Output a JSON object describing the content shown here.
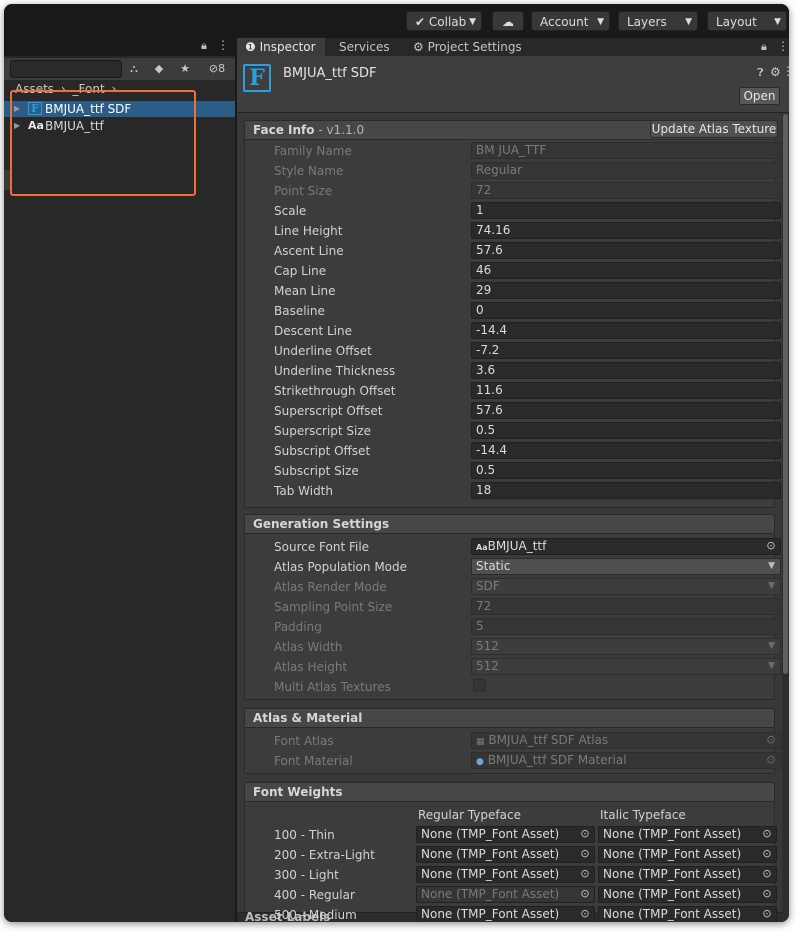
{
  "toolbar": {
    "collab_label": "Collab",
    "account_label": "Account",
    "layers_label": "Layers",
    "layout_label": "Layout"
  },
  "project": {
    "hidden_count": "8",
    "breadcrumb": [
      "Assets",
      "_Font"
    ],
    "items": [
      {
        "label": "BMJUA_ttf SDF",
        "icon": "F",
        "selected": true
      },
      {
        "label": "BMJUA_ttf",
        "icon": "Aa",
        "selected": false
      }
    ]
  },
  "inspector": {
    "tabs": [
      "Inspector",
      "Services",
      "Project Settings"
    ],
    "asset_title": "BMJUA_ttf SDF",
    "open_label": "Open",
    "face_info": {
      "title": "Face Info",
      "version": " - v1.1.0",
      "update_label": "Update Atlas Texture",
      "rows": [
        {
          "label": "Family Name",
          "value": "BM JUA_TTF",
          "disabled": true
        },
        {
          "label": "Style Name",
          "value": "Regular",
          "disabled": true
        },
        {
          "label": "Point Size",
          "value": "72",
          "disabled": true
        },
        {
          "label": "Scale",
          "value": "1",
          "disabled": false
        },
        {
          "label": "Line Height",
          "value": "74.16",
          "disabled": false
        },
        {
          "label": "Ascent Line",
          "value": "57.6",
          "disabled": false
        },
        {
          "label": "Cap Line",
          "value": "46",
          "disabled": false
        },
        {
          "label": "Mean Line",
          "value": "29",
          "disabled": false
        },
        {
          "label": "Baseline",
          "value": "0",
          "disabled": false
        },
        {
          "label": "Descent Line",
          "value": "-14.4",
          "disabled": false
        },
        {
          "label": "Underline Offset",
          "value": "-7.2",
          "disabled": false
        },
        {
          "label": "Underline Thickness",
          "value": "3.6",
          "disabled": false
        },
        {
          "label": "Strikethrough Offset",
          "value": "11.6",
          "disabled": false
        },
        {
          "label": "Superscript Offset",
          "value": "57.6",
          "disabled": false
        },
        {
          "label": "Superscript Size",
          "value": "0.5",
          "disabled": false
        },
        {
          "label": "Subscript Offset",
          "value": "-14.4",
          "disabled": false
        },
        {
          "label": "Subscript Size",
          "value": "0.5",
          "disabled": false
        },
        {
          "label": "Tab Width",
          "value": "18",
          "disabled": false
        }
      ]
    },
    "generation": {
      "title": "Generation Settings",
      "source_font_label": "Source Font File",
      "source_font_value": "BMJUA_ttf",
      "atlas_pop_label": "Atlas Population Mode",
      "atlas_pop_value": "Static",
      "render_mode_label": "Atlas Render Mode",
      "render_mode_value": "SDF",
      "sampling_label": "Sampling Point Size",
      "sampling_value": "72",
      "padding_label": "Padding",
      "padding_value": "5",
      "width_label": "Atlas Width",
      "width_value": "512",
      "height_label": "Atlas Height",
      "height_value": "512",
      "multi_label": "Multi Atlas Textures"
    },
    "atlas_material": {
      "title": "Atlas & Material",
      "font_atlas_label": "Font Atlas",
      "font_atlas_value": "BMJUA_ttf SDF Atlas",
      "font_material_label": "Font Material",
      "font_material_value": "BMJUA_ttf SDF Material"
    },
    "weights": {
      "title": "Font Weights",
      "regular_header": "Regular Typeface",
      "italic_header": "Italic Typeface",
      "rows": [
        {
          "label": "100 - Thin",
          "regular": "None (TMP_Font Asset)",
          "italic": "None (TMP_Font Asset)",
          "regular_disabled": false
        },
        {
          "label": "200 - Extra-Light",
          "regular": "None (TMP_Font Asset)",
          "italic": "None (TMP_Font Asset)",
          "regular_disabled": false
        },
        {
          "label": "300 - Light",
          "regular": "None (TMP_Font Asset)",
          "italic": "None (TMP_Font Asset)",
          "regular_disabled": false
        },
        {
          "label": "400 - Regular",
          "regular": "None (TMP_Font Asset)",
          "italic": "None (TMP_Font Asset)",
          "regular_disabled": true
        },
        {
          "label": "500 - Medium",
          "regular": "None (TMP_Font Asset)",
          "italic": "None (TMP_Font Asset)",
          "regular_disabled": false
        }
      ]
    },
    "asset_labels": "Asset Labels"
  },
  "colors": {
    "highlight": "#e8733a",
    "selection": "#2c5d87",
    "font_icon": "#2a9fe0"
  }
}
